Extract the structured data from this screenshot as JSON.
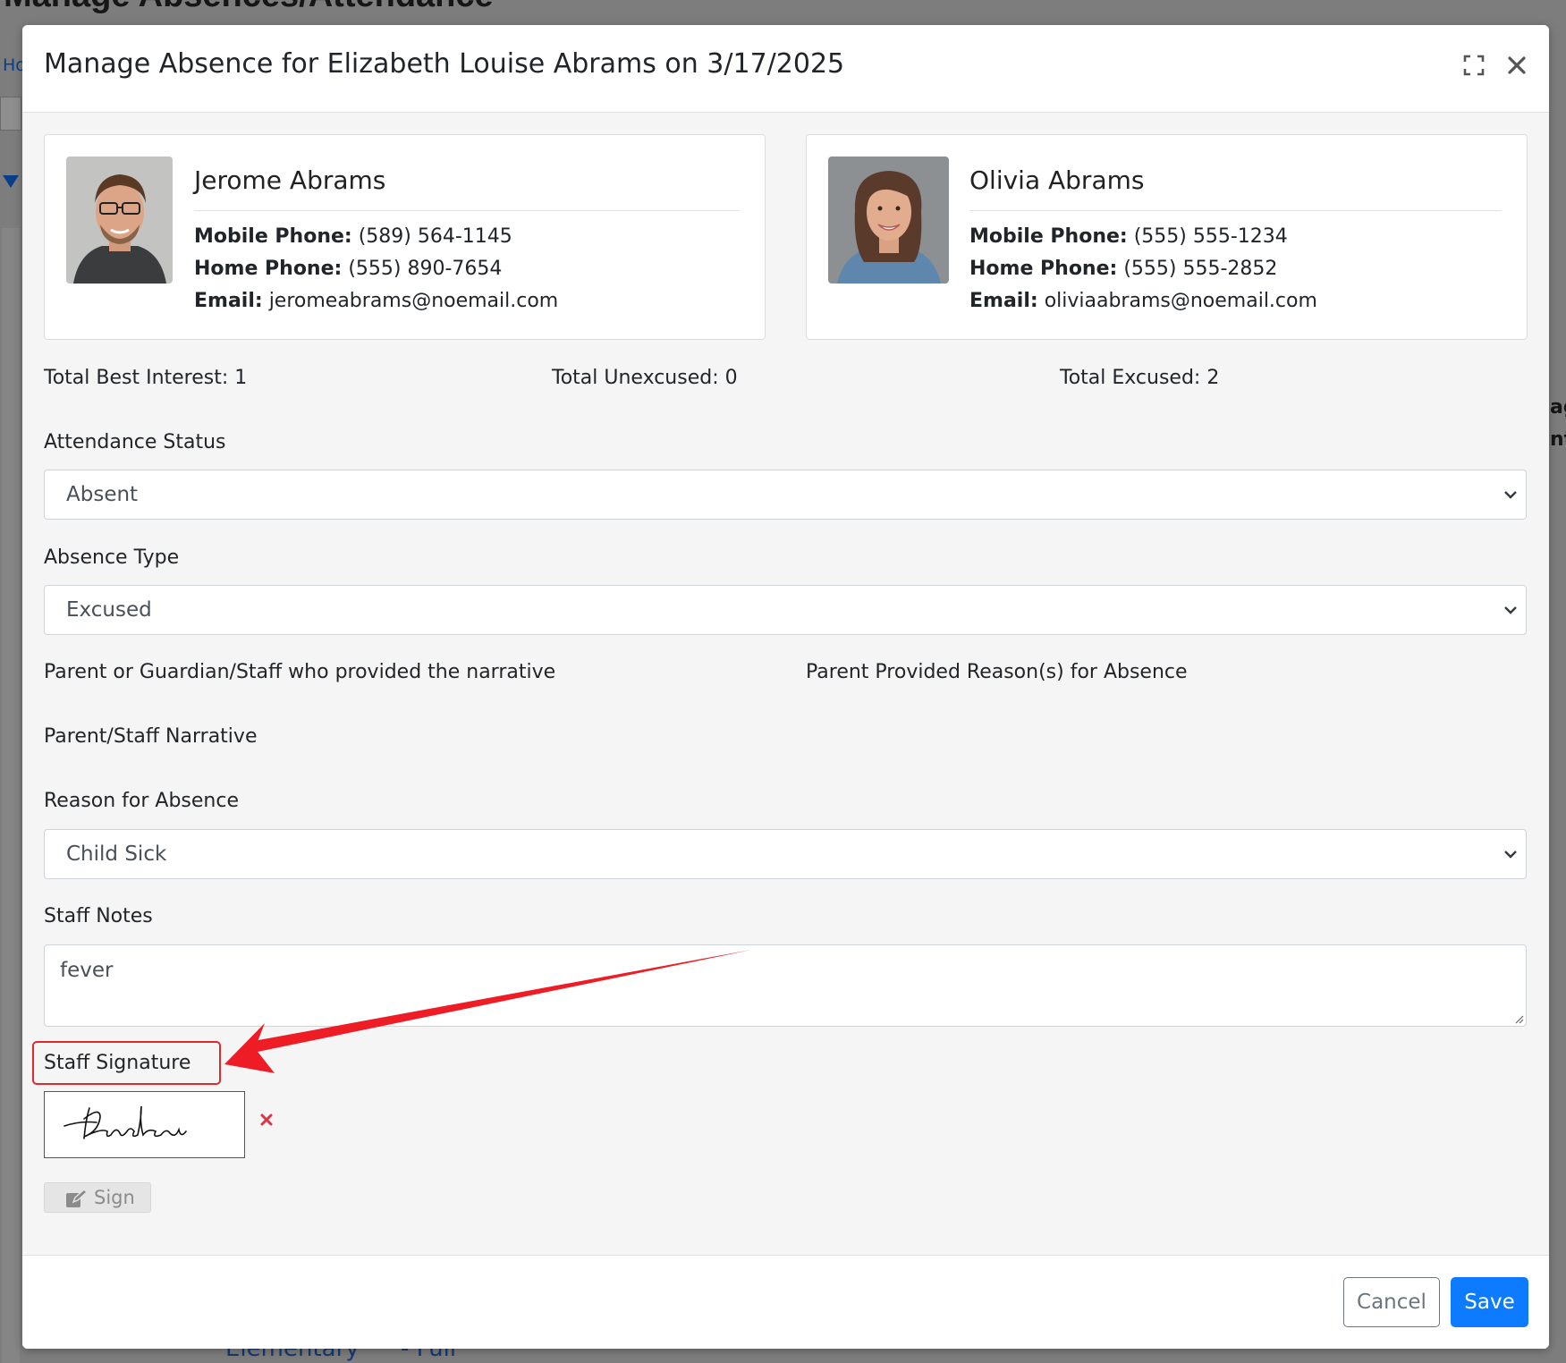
{
  "background": {
    "page_title": "Manage Absences/Attendance",
    "breadcrumb_home": "Ho",
    "right_fragment": [
      "ag",
      "nt/"
    ],
    "bottom_cells": [
      "Elementary",
      "- Full"
    ]
  },
  "modal": {
    "title": "Manage Absence for Elizabeth Louise Abrams on 3/17/2025",
    "header_icons": [
      "expand-icon",
      "close-icon"
    ]
  },
  "parents": [
    {
      "name": "Jerome Abrams",
      "mobile_label": "Mobile Phone:",
      "mobile": "(589) 564-1145",
      "home_label": "Home Phone:",
      "home": "(555) 890-7654",
      "email_label": "Email:",
      "email": "jeromeabrams@noemail.com"
    },
    {
      "name": "Olivia Abrams",
      "mobile_label": "Mobile Phone:",
      "mobile": "(555) 555-1234",
      "home_label": "Home Phone:",
      "home": "(555) 555-2852",
      "email_label": "Email:",
      "email": "oliviaabrams@noemail.com"
    }
  ],
  "totals": {
    "best_interest": "Total Best Interest: 1",
    "unexcused": "Total Unexcused: 0",
    "excused": "Total Excused: 2"
  },
  "form": {
    "attendance_status_label": "Attendance Status",
    "attendance_status_value": "Absent",
    "absence_type_label": "Absence Type",
    "absence_type_value": "Excused",
    "narrative_provider_label": "Parent or Guardian/Staff who provided the narrative",
    "parent_reasons_label": "Parent Provided Reason(s) for Absence",
    "narrative_label": "Parent/Staff Narrative",
    "reason_label": "Reason for Absence",
    "reason_value": "Child Sick",
    "staff_notes_label": "Staff Notes",
    "staff_notes_value": "fever",
    "staff_signature_label": "Staff Signature",
    "sign_button": "Sign"
  },
  "footer": {
    "cancel": "Cancel",
    "save": "Save"
  },
  "colors": {
    "primary": "#0d7bff",
    "annotation_red": "#e0282d",
    "overlay": "#7d7d7d"
  }
}
